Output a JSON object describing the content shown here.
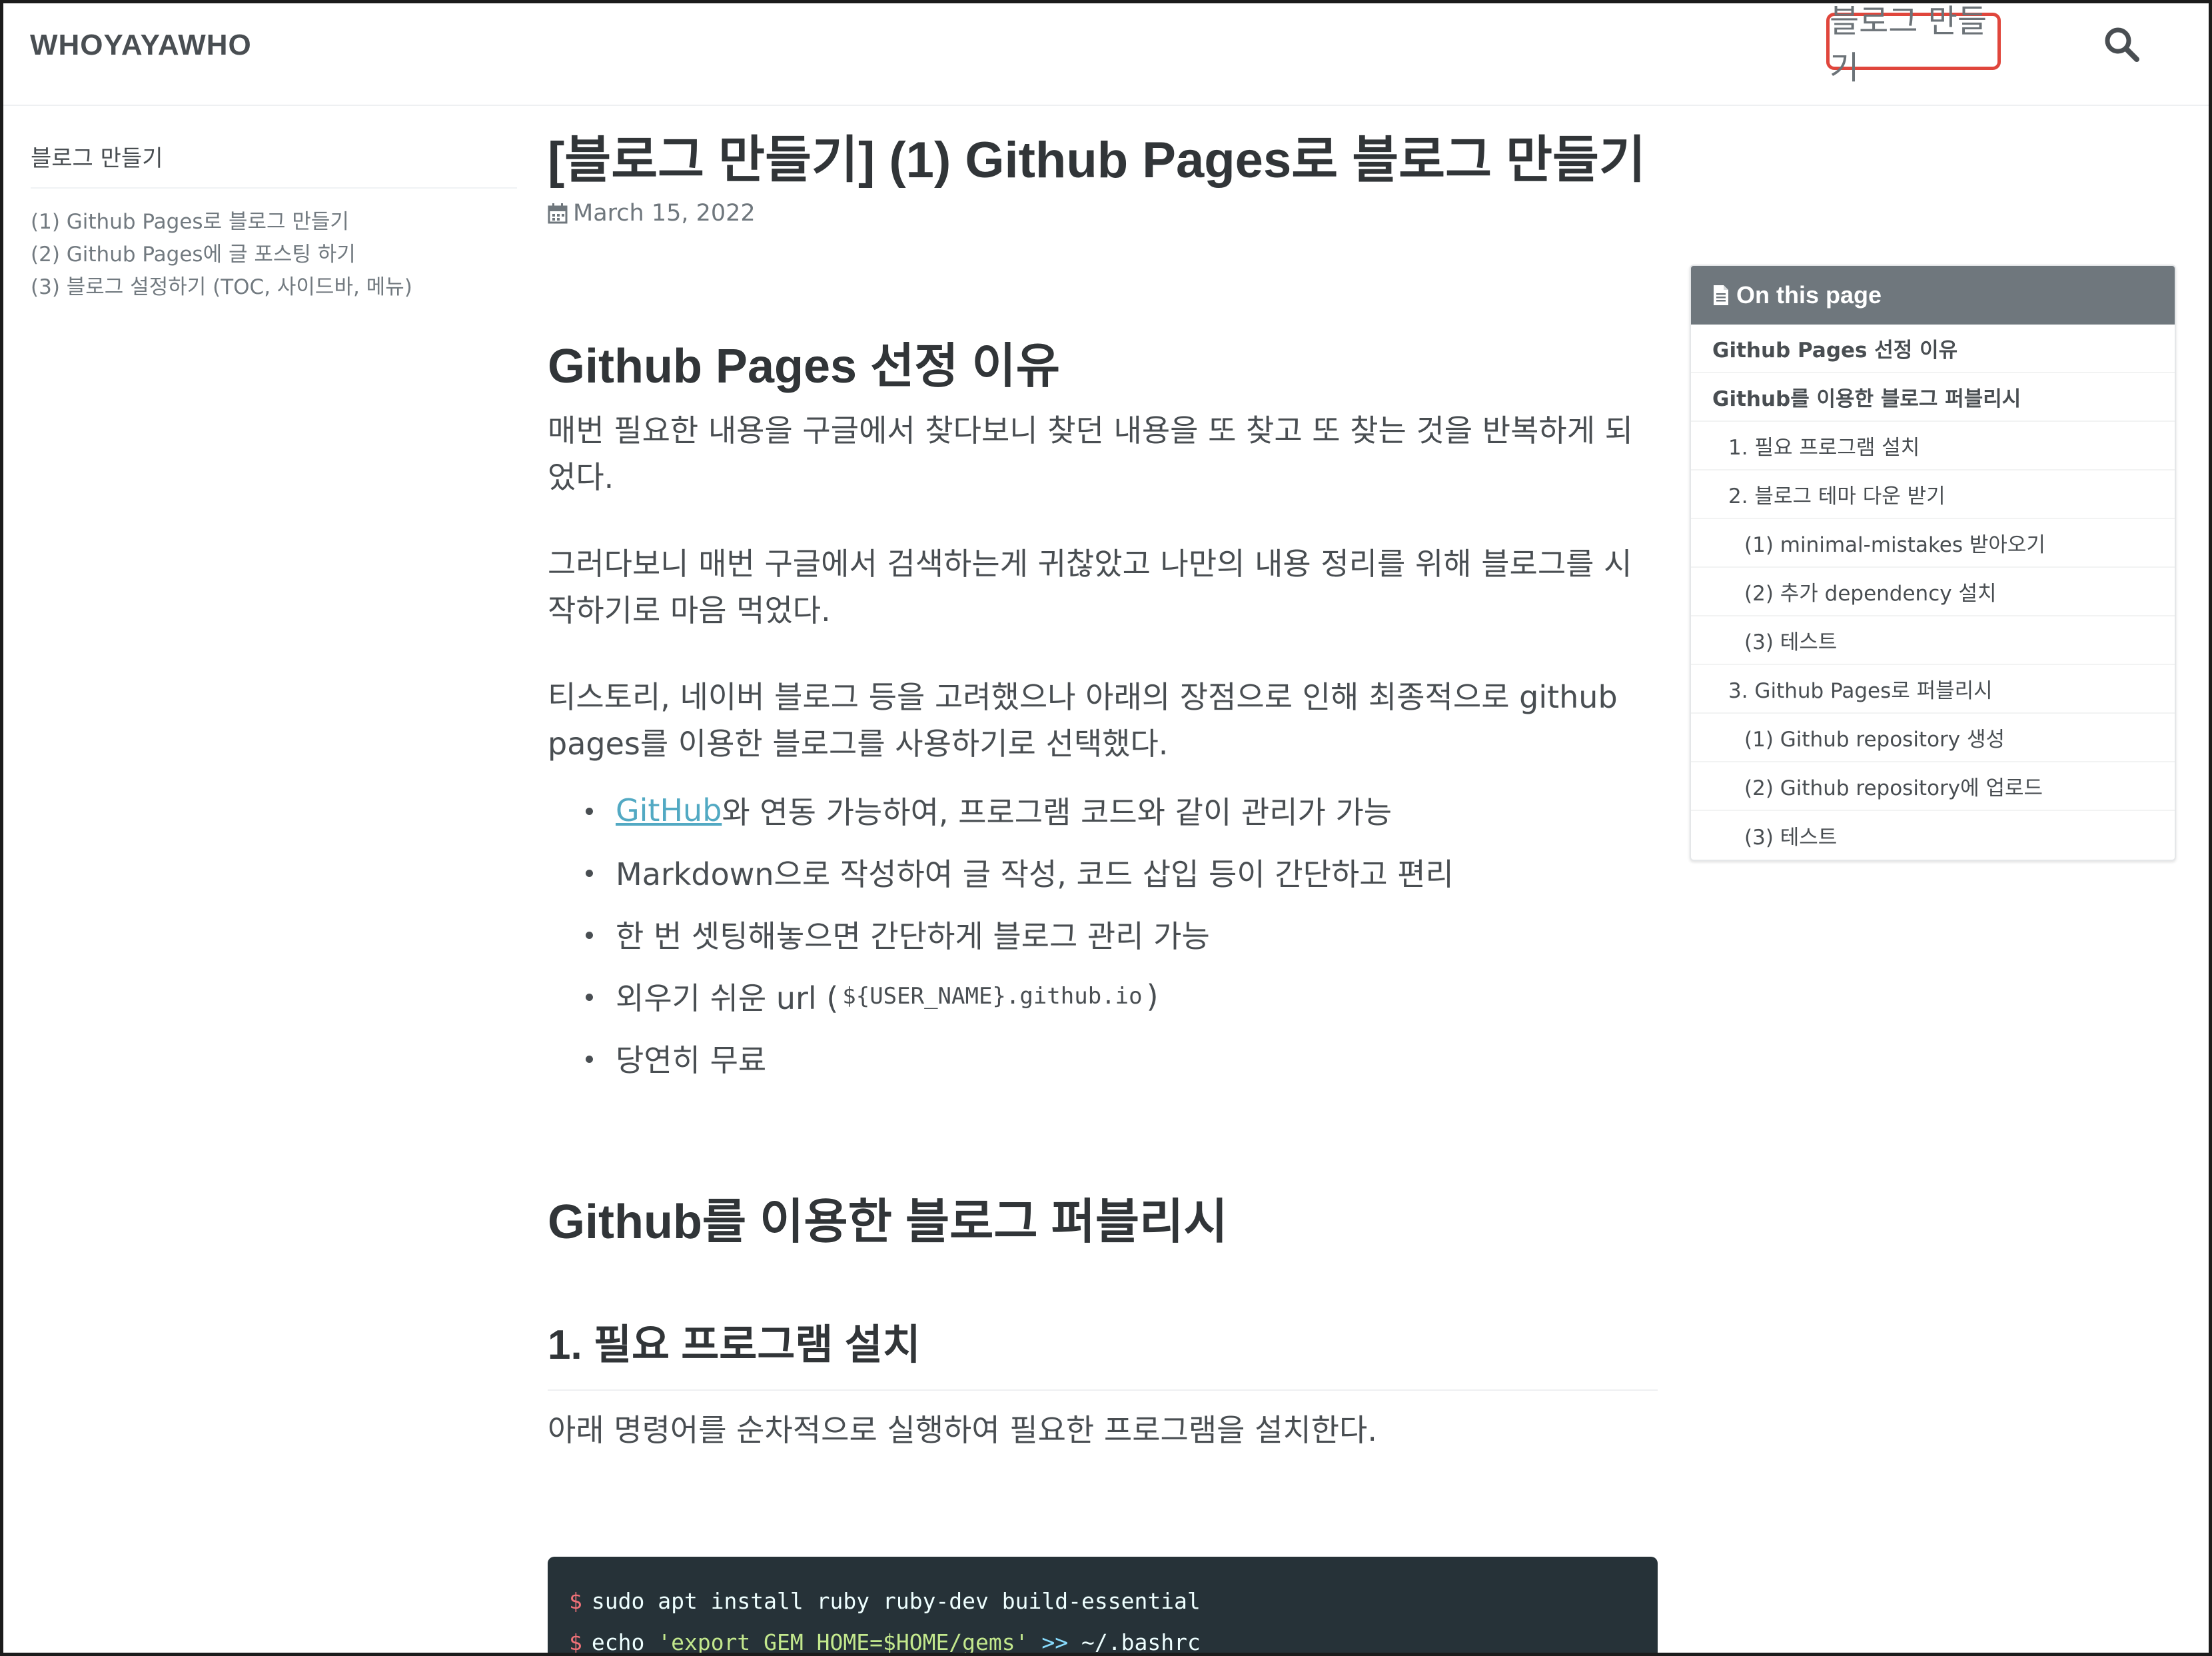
{
  "masthead": {
    "site_title": "WHOYAYAWHO",
    "nav_link": "블로그 만들기",
    "search_icon": "search-icon"
  },
  "sidebar": {
    "title": "블로그 만들기",
    "items": [
      "(1) Github Pages로 블로그 만들기",
      "(2) Github Pages에 글 포스팅 하기",
      "(3) 블로그 설정하기 (TOC, 사이드바, 메뉴)"
    ]
  },
  "post": {
    "title": "[블로그 만들기] (1) Github Pages로 블로그 만들기",
    "date_icon": "calendar-icon",
    "date": "March 15, 2022",
    "section1_heading": "Github Pages 선정 이유",
    "paragraphs": [
      "매번 필요한 내용을 구글에서 찾다보니 찾던 내용을 또 찾고 또 찾는 것을 반복하게 되었다.",
      "그러다보니 매번 구글에서 검색하는게 귀찮았고 나만의 내용 정리를 위해 블로그를 시작하기로 마음 먹었다.",
      "티스토리, 네이버 블로그 등을 고려했으나 아래의 장점으로 인해 최종적으로 github pages를 이용한 블로그를 사용하기로 선택했다."
    ],
    "bullets": {
      "b1_link": "GitHub",
      "b1_rest": "와 연동 가능하여, 프로그램 코드와 같이 관리가 가능",
      "b2": "Markdown으로 작성하여 글 작성, 코드 삽입 등이 간단하고 편리",
      "b3": "한 번 셋팅해놓으면 간단하게 블로그 관리 가능",
      "b4_pre": "외우기 쉬운 url (",
      "b4_code": "${USER_NAME}.github.io",
      "b4_post": ")",
      "b5": "당연히 무료"
    },
    "section2_heading": "Github를 이용한 블로그 퍼블리시",
    "section3_heading": "1. 필요 프로그램 설치",
    "section3_text": "아래 명령어를 순차적으로 실행하여 필요한 프로그램을 설치한다.",
    "code": {
      "prompt": "$",
      "line1": "sudo apt install ruby ruby-dev build-essential",
      "line2_cmd": "echo ",
      "line2_str": "'export GEM_HOME=$HOME/gems'",
      "line2_op": ">>",
      "line2_rest": "~/.bashrc"
    }
  },
  "toc": {
    "header_icon": "file-text-icon",
    "header": "On this page",
    "items": [
      "Github Pages 선정 이유",
      "Github를 이용한 블로그 퍼블리시",
      "1. 필요 프로그램 설치",
      "2. 블로그 테마 다운 받기",
      "(1) minimal-mistakes 받아오기",
      "(2) 추가 dependency 설치",
      "(3) 테스트",
      "3. Github Pages로 퍼블리시",
      "(1) Github repository 생성",
      "(2) Github repository에 업로드",
      "(3) 테스트"
    ]
  },
  "colors": {
    "nav_highlight": "#e0463c",
    "link": "#52a9c3",
    "toc_header_bg": "#6f777d",
    "code_bg": "#263238"
  }
}
